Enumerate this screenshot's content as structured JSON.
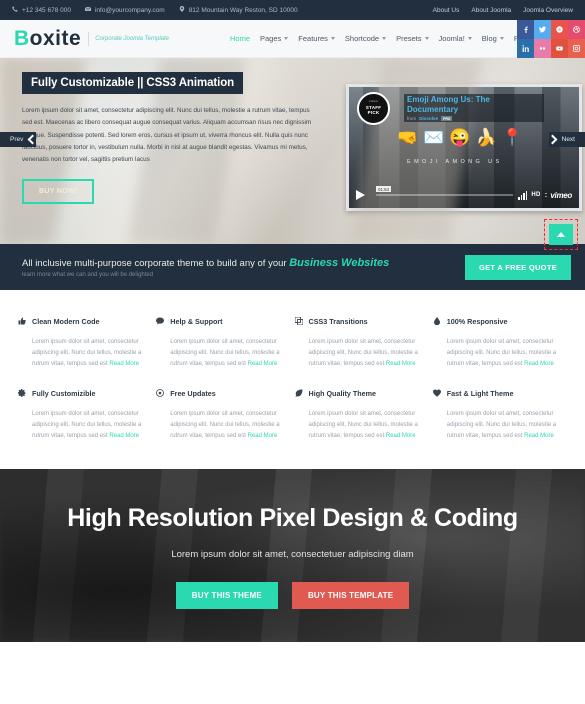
{
  "topbar": {
    "phone": "+12 345 678 000",
    "email": "info@yourcompany.com",
    "address": "812 Mountain Way Reston, SD 10000",
    "links": [
      "About Us",
      "About Joomla",
      "Joomla Overview"
    ]
  },
  "header": {
    "logo_first": "B",
    "logo_rest": "oxite",
    "tagline": "Corporate Joomla Template",
    "nav": [
      {
        "label": "Home",
        "caret": false,
        "active": true
      },
      {
        "label": "Pages",
        "caret": true,
        "active": false
      },
      {
        "label": "Features",
        "caret": true,
        "active": false
      },
      {
        "label": "Shortcode",
        "caret": true,
        "active": false
      },
      {
        "label": "Presets",
        "caret": true,
        "active": false
      },
      {
        "label": "Joomla!",
        "caret": true,
        "active": false
      },
      {
        "label": "Blog",
        "caret": true,
        "active": false
      },
      {
        "label": "Po",
        "caret": false,
        "active": false
      }
    ],
    "social": [
      {
        "name": "facebook-icon",
        "color": "#3b5998"
      },
      {
        "name": "twitter-icon",
        "color": "#55acee"
      },
      {
        "name": "skype-icon",
        "color": "#e8544a"
      },
      {
        "name": "dribbble-icon",
        "color": "#e54b6e"
      },
      {
        "name": "linkedin-icon",
        "color": "#2a6fa8"
      },
      {
        "name": "flickr-icon",
        "color": "#e87ca8"
      },
      {
        "name": "youtube-icon",
        "color": "#e0513f"
      },
      {
        "name": "instagram-icon",
        "color": "#e8604f"
      }
    ]
  },
  "hero": {
    "title": "Fully Customizable || CSS3 Animation",
    "body": "Lorem ipsum dolor sit amet, consectetur adipiscing elit. Nunc dui tellus, molestie a rutrum vitae, tempus sed est. Maecenas ac libero consequat augue consequat varius. Aliquam accumsan risus nec dignissim tristique. Suspendisse potenti. Sed lorem eros, cursus et ipsum ut, viverra rhoncus elit. Nulla quis nunc faucibus, posuere tortor in, vestibulum nulla. Morbi in nisl at augue blandit egestas. Vivamus mi metus, venenatis non tortor vel, sagittis pretium lacus",
    "cta": "BUY NOW!",
    "prev": "Prev",
    "next": "Next"
  },
  "video": {
    "badge_top": "vimeo",
    "badge_line1": "STAFF",
    "badge_line2": "PICK",
    "title": "Emoji Among Us: The Documentary",
    "from_label": "from",
    "author": "Dissolve",
    "pro_badge": "PRO",
    "caption": "EMOJI AMONG US",
    "time": "01:54",
    "quality": "HD",
    "brand": "vimeo",
    "emojis": [
      "🤜",
      "✉️",
      "😜",
      "🍌",
      "📍"
    ]
  },
  "cta_banner": {
    "line1_a": "All inclusive multi-purpose corporate theme to build any of your ",
    "line1_em": "Business Websites",
    "line2": "learn more what we can and you will be delighted",
    "button": "GET A FREE QUOTE",
    "scroll_top_icon": "chevron-up-icon",
    "accent": "#2bd9b0",
    "highlight": "#fb2b2b"
  },
  "features": {
    "body_text": "Lorem ipsum dolor sit amet, consectetur adipiscing elit. Nunc dui tellus, molestie a rutrum vitae, tempus sed est ",
    "read_more": "Read More",
    "items": [
      {
        "title": "Clean Modern Code",
        "icon": "thumbs-up-icon"
      },
      {
        "title": "Help & Support",
        "icon": "comment-icon"
      },
      {
        "title": "CSS3 Transitions",
        "icon": "clone-icon"
      },
      {
        "title": "100% Responsive",
        "icon": "tint-icon"
      },
      {
        "title": "Fully Customizible",
        "icon": "gear-icon"
      },
      {
        "title": "Free Updates",
        "icon": "refresh-icon"
      },
      {
        "title": "High Quality Theme",
        "icon": "leaf-icon"
      },
      {
        "title": "Fast & Light Theme",
        "icon": "heart-icon"
      }
    ]
  },
  "promo": {
    "heading": "High Resolution Pixel Design & Coding",
    "sub": "Lorem ipsum dolor sit amet, consectetuer adipiscing diam",
    "btn_primary": "BUY THIS THEME",
    "btn_secondary": "BUY THIS TEMPLATE"
  }
}
